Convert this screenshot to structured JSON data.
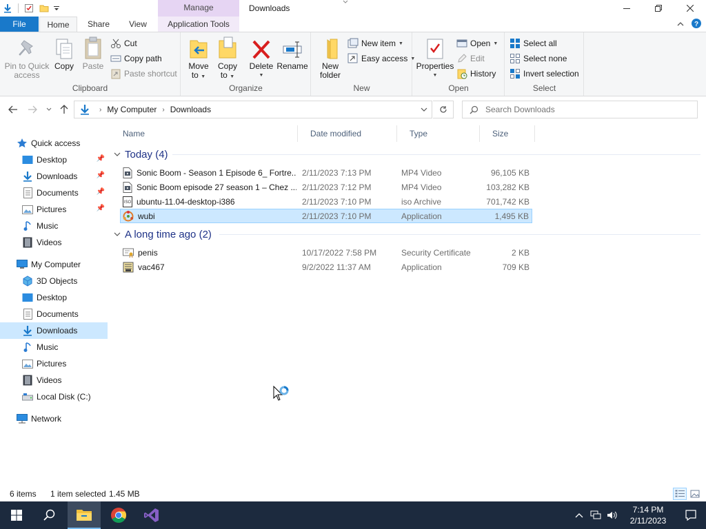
{
  "window": {
    "title": "Downloads",
    "context_tab": "Manage"
  },
  "ribbon_tabs": {
    "file": "File",
    "home": "Home",
    "share": "Share",
    "view": "View",
    "application_tools": "Application Tools"
  },
  "ribbon": {
    "clipboard": {
      "label": "Clipboard",
      "pin_line1": "Pin to Quick",
      "pin_line2": "access",
      "copy": "Copy",
      "paste": "Paste",
      "cut": "Cut",
      "copy_path": "Copy path",
      "paste_shortcut": "Paste shortcut"
    },
    "organize": {
      "label": "Organize",
      "move_line1": "Move",
      "move_line2": "to",
      "copy_line1": "Copy",
      "copy_line2": "to",
      "delete": "Delete",
      "rename": "Rename"
    },
    "new": {
      "label": "New",
      "folder_line1": "New",
      "folder_line2": "folder",
      "new_item": "New item",
      "easy_access": "Easy access"
    },
    "open": {
      "label": "Open",
      "properties": "Properties",
      "open": "Open",
      "edit": "Edit",
      "history": "History"
    },
    "select": {
      "label": "Select",
      "select_all": "Select all",
      "select_none": "Select none",
      "invert": "Invert selection"
    }
  },
  "address": {
    "root": "My Computer",
    "current": "Downloads",
    "search_placeholder": "Search Downloads"
  },
  "nav_pane": {
    "quick_access": "Quick access",
    "quick_items": [
      "Desktop",
      "Downloads",
      "Documents",
      "Pictures",
      "Music",
      "Videos"
    ],
    "my_computer": "My Computer",
    "computer_items": [
      "3D Objects",
      "Desktop",
      "Documents",
      "Downloads",
      "Music",
      "Pictures",
      "Videos",
      "Local Disk (C:)"
    ],
    "network": "Network"
  },
  "columns": {
    "name": "Name",
    "date": "Date modified",
    "type": "Type",
    "size": "Size"
  },
  "groups": [
    {
      "title": "Today (4)",
      "files": [
        {
          "name": "Sonic Boom - Season 1 Episode 6_ Fortre...",
          "date": "2/11/2023 7:13 PM",
          "type": "MP4 Video",
          "size": "96,105 KB",
          "icon": "video-file-icon"
        },
        {
          "name": "Sonic Boom episode 27 season 1 – Chez ...",
          "date": "2/11/2023 7:12 PM",
          "type": "MP4 Video",
          "size": "103,282 KB",
          "icon": "video-file-icon"
        },
        {
          "name": "ubuntu-11.04-desktop-i386",
          "date": "2/11/2023 7:10 PM",
          "type": "iso Archive",
          "size": "701,742 KB",
          "icon": "iso-file-icon"
        },
        {
          "name": "wubi",
          "date": "2/11/2023 7:10 PM",
          "type": "Application",
          "size": "1,495 KB",
          "icon": "wubi-app-icon",
          "selected": true
        }
      ]
    },
    {
      "title": "A long time ago (2)",
      "files": [
        {
          "name": "penis",
          "date": "10/17/2022 7:58 PM",
          "type": "Security Certificate",
          "size": "2 KB",
          "icon": "certificate-icon"
        },
        {
          "name": "vac467",
          "date": "9/2/2022 11:37 AM",
          "type": "Application",
          "size": "709 KB",
          "icon": "app-icon"
        }
      ]
    }
  ],
  "status": {
    "items": "6 items",
    "selected": "1 item selected",
    "size": "1.45 MB"
  },
  "taskbar": {
    "time": "7:14 PM",
    "date": "2/11/2023"
  },
  "colors": {
    "accent": "#1979ca",
    "selection": "#cce8ff",
    "taskbar": "#1c2a3e",
    "context_tab": "#e6d5f3",
    "group_header": "#1e3287"
  }
}
